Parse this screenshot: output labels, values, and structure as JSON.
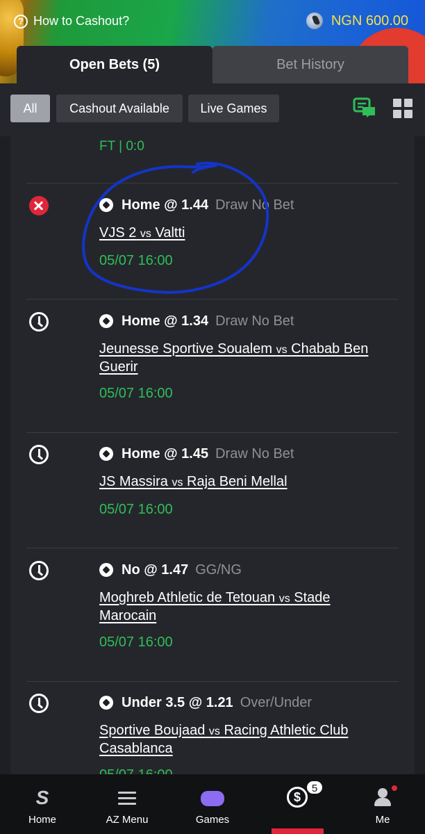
{
  "header": {
    "help_label": "How to Cashout?",
    "balance": "NGN 600.00",
    "balance_color": "#f6e14a"
  },
  "tabs": [
    {
      "label": "Open Bets (5)",
      "active": true
    },
    {
      "label": "Bet History",
      "active": false
    }
  ],
  "filters": [
    {
      "label": "All",
      "active": true
    },
    {
      "label": "Cashout Available",
      "active": false
    },
    {
      "label": "Live Games",
      "active": false
    }
  ],
  "previous_result": "FT | 0:0",
  "bets": [
    {
      "status_icon": "lost-x-icon",
      "pick": "Home @ 1.44",
      "market": "Draw No Bet",
      "home": "VJS 2",
      "vs": "vs",
      "away": "Valtti",
      "time": "05/07 16:00",
      "highlighted": true
    },
    {
      "status_icon": "clock-icon",
      "pick": "Home @ 1.34",
      "market": "Draw No Bet",
      "home": "Jeunesse Sportive Soualem",
      "vs": "vs",
      "away": "Chabab Ben Guerir",
      "time": "05/07 16:00"
    },
    {
      "status_icon": "clock-icon",
      "pick": "Home @ 1.45",
      "market": "Draw No Bet",
      "home": "JS Massira",
      "vs": "vs",
      "away": "Raja Beni Mellal",
      "time": "05/07 16:00"
    },
    {
      "status_icon": "clock-icon",
      "pick": "No @ 1.47",
      "market": "GG/NG",
      "home": "Moghreb Athletic de Tetouan",
      "vs": "vs",
      "away": "Stade Marocain",
      "time": "05/07 16:00"
    },
    {
      "status_icon": "clock-icon",
      "pick": "Under 3.5 @ 1.21",
      "market": "Over/Under",
      "home": "Sportive Boujaad",
      "vs": "vs",
      "away": "Racing Athletic Club Casablanca",
      "time": "05/07 16:00"
    }
  ],
  "nav": {
    "items": [
      {
        "label": "Home",
        "icon": "sporty-logo-icon"
      },
      {
        "label": "AZ Menu",
        "icon": "hamburger-icon"
      },
      {
        "label": "Games",
        "icon": "gamepad-icon"
      },
      {
        "label": "",
        "icon": "cashout-icon"
      },
      {
        "label": "Me",
        "icon": "user-icon"
      }
    ],
    "cashout_badge": "5",
    "home_glyph": "S",
    "cash_glyph": "$"
  },
  "colors": {
    "accent_green": "#2fbe57",
    "lost_red": "#e0263a",
    "background": "#1e1f24",
    "annotation_blue": "#1434c8"
  }
}
